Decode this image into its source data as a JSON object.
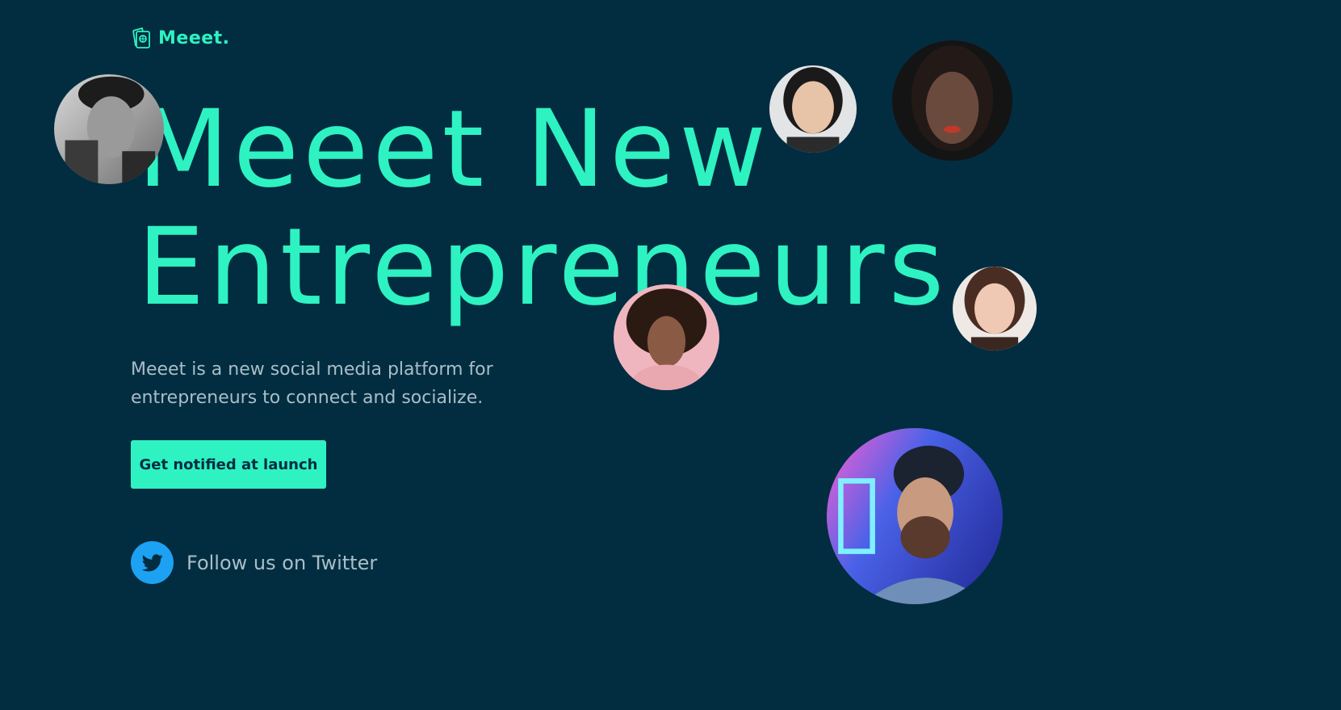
{
  "brand": {
    "name": "Meeet.",
    "icon": "passport-icon",
    "accent_color": "#2ef2c2",
    "background_color": "#022d40"
  },
  "hero": {
    "headline_line1": "Meeet New",
    "headline_line2": "Entrepreneurs",
    "subtitle": "Meeet is a new social media platform for entrepreneurs to connect and socialize."
  },
  "cta": {
    "label": "Get notified at launch"
  },
  "social": {
    "twitter_label": "Follow us on Twitter",
    "twitter_icon": "twitter-bird-icon",
    "twitter_color": "#1da1f2"
  },
  "avatars": [
    {
      "description": "black-and-white portrait of a curly-haired man"
    },
    {
      "description": "woman with dark hair on light background"
    },
    {
      "description": "woman with dark hair and red lips, dark background"
    },
    {
      "description": "woman with auburn hair on light background"
    },
    {
      "description": "girl with curly afro hair on pink background"
    },
    {
      "description": "bearded man in beanie with neon lights"
    }
  ]
}
